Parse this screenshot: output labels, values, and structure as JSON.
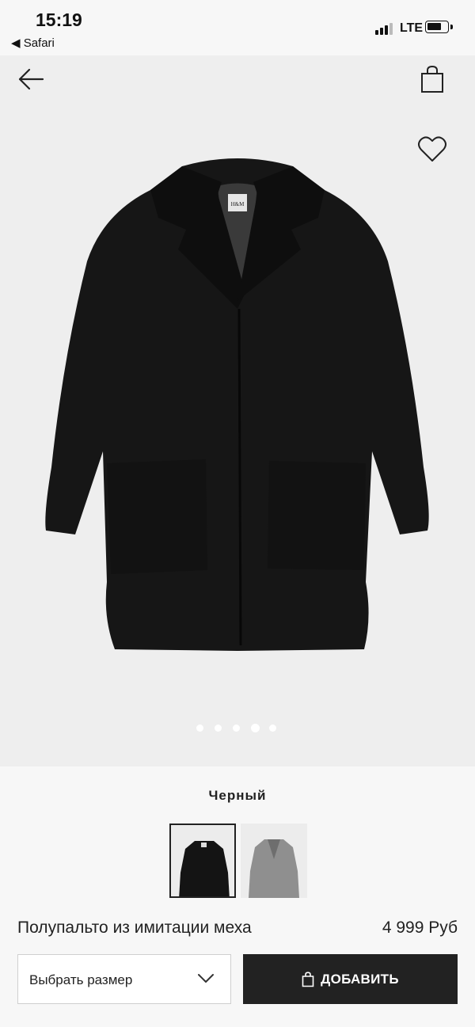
{
  "status_bar": {
    "time": "15:19",
    "back_app": "◀ Safari",
    "network": "LTE"
  },
  "product_image": {
    "carousel_total": 5,
    "carousel_active_index": 4,
    "brand_label": "H&M"
  },
  "color_section": {
    "selected_color": "Черный",
    "swatches": [
      {
        "name": "black",
        "color": "#141414",
        "selected": true
      },
      {
        "name": "grey",
        "color": "#8f8f8f",
        "selected": false
      }
    ]
  },
  "product": {
    "title": "Полупальто из имитации меха",
    "price": "4 999 Руб"
  },
  "actions": {
    "size_placeholder": "Выбрать размер",
    "add_button": "ДОБАВИТЬ"
  },
  "colors": {
    "button_bg": "#222222",
    "background": "#eeeeee"
  }
}
